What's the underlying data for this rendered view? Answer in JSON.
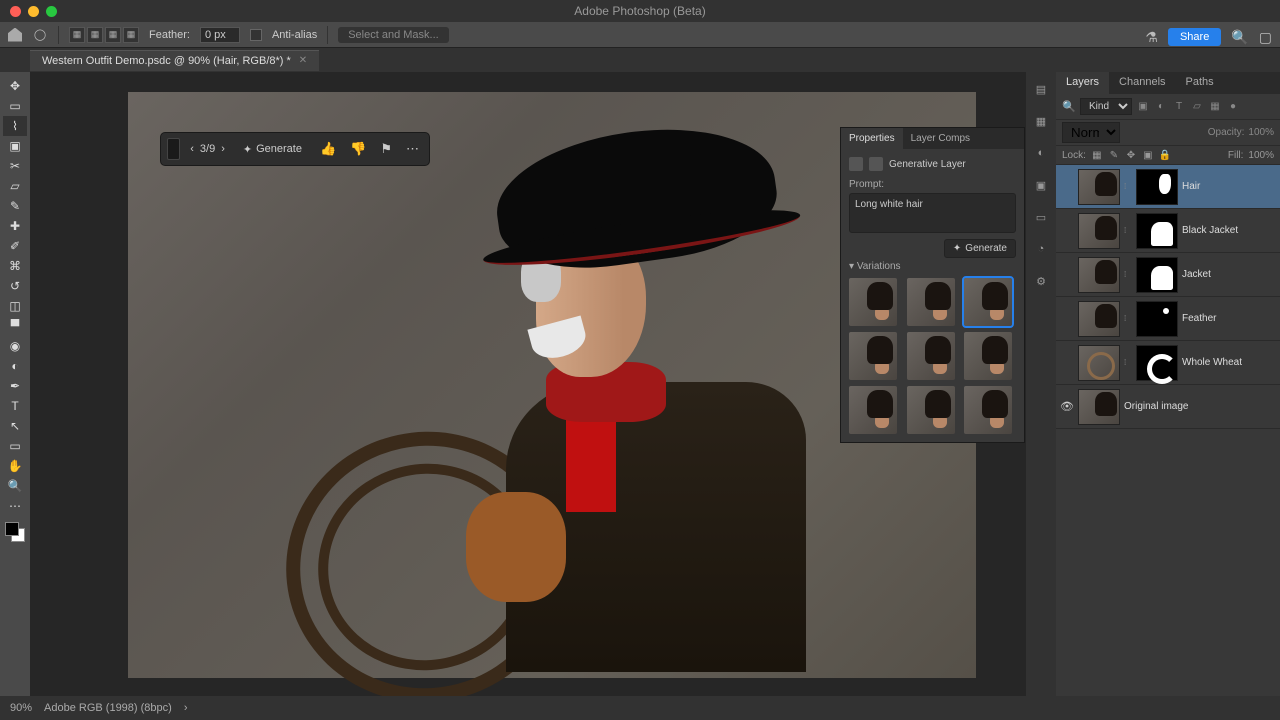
{
  "app": {
    "title": "Adobe Photoshop (Beta)"
  },
  "options": {
    "feather_label": "Feather:",
    "feather_value": "0 px",
    "antialias_label": "Anti-alias",
    "select_mask_label": "Select and Mask..."
  },
  "doc_tab": {
    "title": "Western Outfit Demo.psdc @ 90% (Hair, RGB/8*) *"
  },
  "share": {
    "label": "Share"
  },
  "gen_toolbar": {
    "counter": "3/9",
    "generate_label": "Generate"
  },
  "properties": {
    "tab_properties": "Properties",
    "tab_layer_comps": "Layer Comps",
    "layer_type": "Generative Layer",
    "prompt_label": "Prompt:",
    "prompt_value": "Long white hair",
    "generate_btn": "Generate",
    "variations_label": "Variations",
    "variation_count": 9,
    "selected_variation_index": 2
  },
  "panels": {
    "tab_layers": "Layers",
    "tab_channels": "Channels",
    "tab_paths": "Paths",
    "kind_label": "Kind",
    "blend_mode": "Normal",
    "opacity_label": "Opacity:",
    "opacity_value": "100%",
    "lock_label": "Lock:",
    "fill_label": "Fill:",
    "fill_value": "100%"
  },
  "layers": [
    {
      "name": "Hair",
      "selected": true,
      "mask": "m1",
      "visible": false
    },
    {
      "name": "Black Jacket",
      "selected": false,
      "mask": "m2",
      "visible": false
    },
    {
      "name": "Jacket",
      "selected": false,
      "mask": "m2",
      "visible": false
    },
    {
      "name": "Feather",
      "selected": false,
      "mask": "m3",
      "visible": false
    },
    {
      "name": "Whole Wheat",
      "selected": false,
      "mask": "m4",
      "visible": false,
      "circle": true
    },
    {
      "name": "Original image",
      "selected": false,
      "mask": null,
      "visible": true
    }
  ],
  "status": {
    "zoom": "90%",
    "profile": "Adobe RGB (1998) (8bpc)"
  }
}
